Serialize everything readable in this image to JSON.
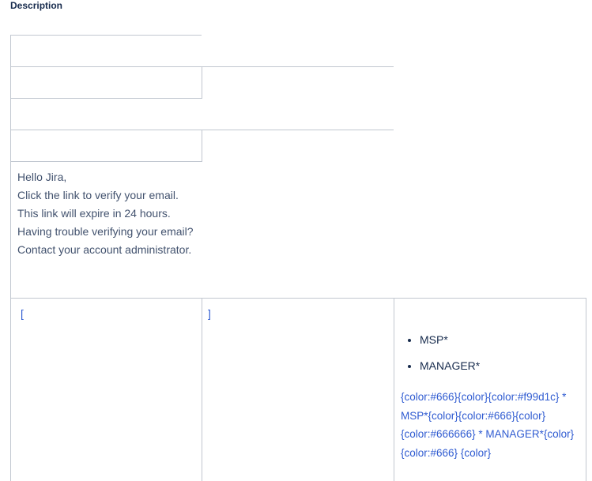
{
  "field_label": "Description",
  "email_lines": [
    "Hello Jira,",
    "Click the link to verify your email.",
    "This link will expire in 24 hours.",
    "Having trouble verifying your email?",
    "Contact your account administrator."
  ],
  "table": {
    "cell1": "[",
    "cell2": "]",
    "bullets": [
      "MSP*",
      "MANAGER*"
    ],
    "markup_lines": [
      "{color:#666}{color}{color:#f99d1c} *",
      "MSP*{color}{color:#666}{color}",
      "{color:#666666} * MANAGER*{color}",
      "{color:#666} {color}"
    ]
  }
}
